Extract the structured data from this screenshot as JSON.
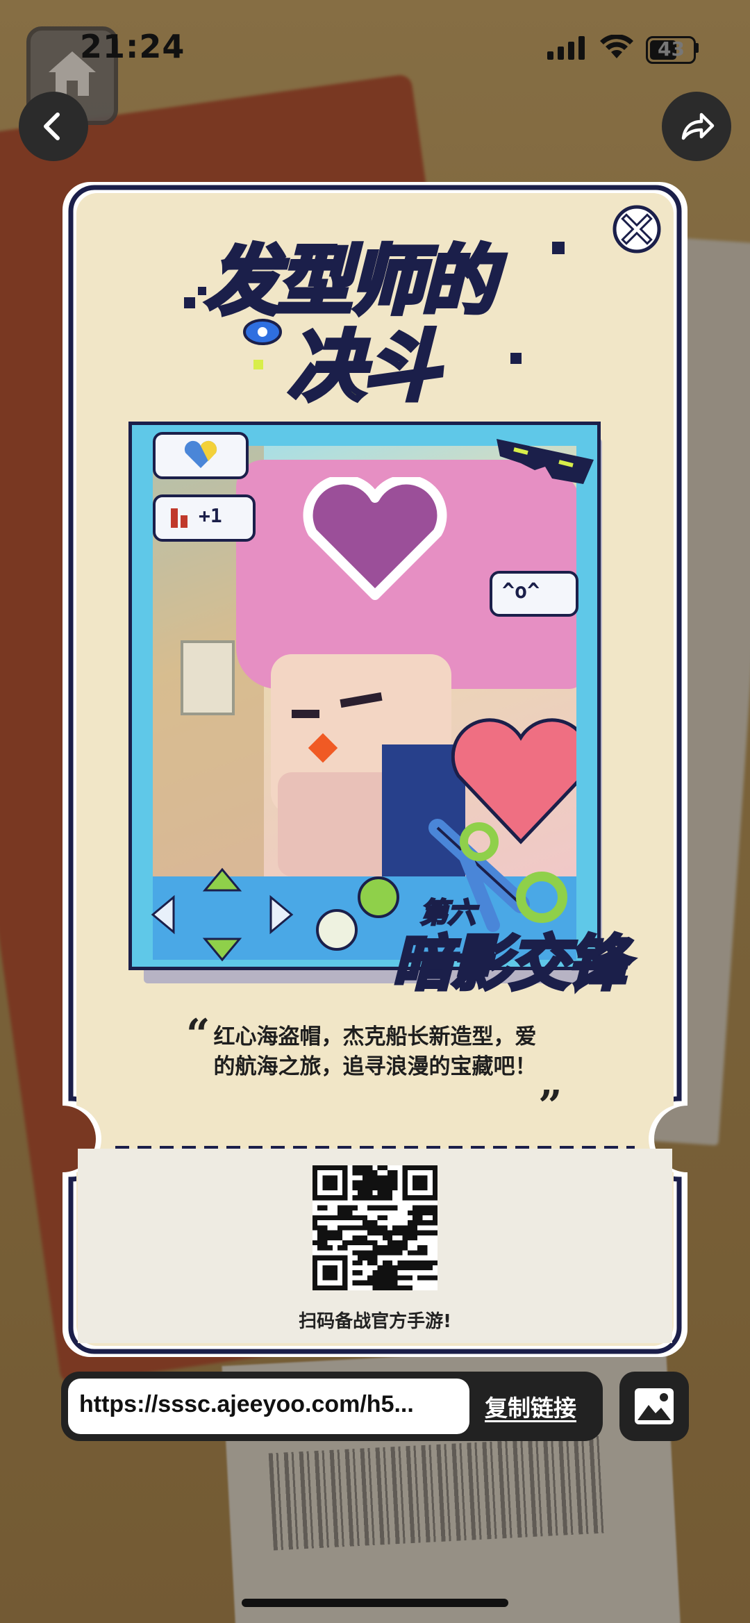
{
  "status_bar": {
    "time": "21:24",
    "battery": "43"
  },
  "nav": {
    "back_icon": "chevron-left-icon",
    "share_icon": "share-arrow-icon",
    "home_icon": "home-icon"
  },
  "card": {
    "logo_line1_a": "发型师",
    "logo_line1_b": "的",
    "logo_line2": "决斗",
    "poster": {
      "bubble_face": "^o^",
      "bubble_stat": "+1",
      "brand_main": "暗影交锋",
      "brand_small": "第六"
    },
    "quote": "红心海盗帽，杰克船长新造型，爱的航海之旅，追寻浪漫的宝藏吧！",
    "quote_open": "“",
    "quote_close": "”",
    "scan_label": "扫码备战官方手游!"
  },
  "link_bar": {
    "url": "https://sssc.ajeeyoo.com/h5...",
    "copy_label": "复制链接",
    "image_icon": "image-icon"
  },
  "colors": {
    "ticket_bg": "#f3ecd9",
    "ticket_border": "#1b1f4a",
    "bar_bg": "#222222"
  }
}
